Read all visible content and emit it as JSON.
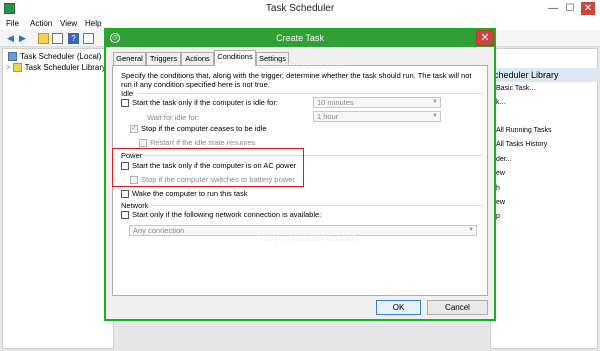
{
  "main_window": {
    "title": "Task Scheduler",
    "controls": {
      "minimize": "—",
      "maximize": "☐",
      "close": "✕"
    },
    "menu": [
      "File",
      "Action",
      "View",
      "Help"
    ]
  },
  "tree": {
    "items": [
      "Task Scheduler (Local)",
      "Task Scheduler Library"
    ],
    "expander": ">"
  },
  "actions_pane": {
    "header": "cheduler Library",
    "items": [
      "Basic Task...",
      "k...",
      "All Running Tasks",
      "All Tasks History",
      "der...",
      "ew",
      "h",
      "ew",
      "p"
    ]
  },
  "dialog": {
    "title": "Create Task",
    "close_glyph": "✕",
    "tabs": [
      "General",
      "Triggers",
      "Actions",
      "Conditions",
      "Settings"
    ],
    "active_tab": "Conditions",
    "description_line1": "Specify the conditions that, along with the trigger, determine whether the task should run.  The task will not",
    "description_line2": "run  if any condition specified here is not true.",
    "idle": {
      "group": "Idle",
      "start_if_idle": "Start the task only if the computer is idle for:",
      "idle_duration": "10 minutes",
      "wait_label": "Wait for idle for:",
      "wait_duration": "1 hour",
      "stop_if_ceases": "Stop if the computer ceases to be idle",
      "restart_if_resumes": "Restart if the idle state resumes"
    },
    "power": {
      "group": "Power",
      "ac_power": "Start the task only if the computer is on AC power",
      "battery": "Stop if the computer switches to battery power",
      "wake": "Wake the computer to run this task"
    },
    "network": {
      "group": "Network",
      "connection_only": "Start only if the following network connection is available:",
      "connection": "Any connection"
    },
    "buttons": {
      "ok": "OK",
      "cancel": "Cancel"
    }
  },
  "watermark": "http://winaero.com",
  "colors": {
    "dialog_border": "#19b21d",
    "highlight_box": "#e2161b",
    "dialog_titlebar": "#2f9f36"
  }
}
